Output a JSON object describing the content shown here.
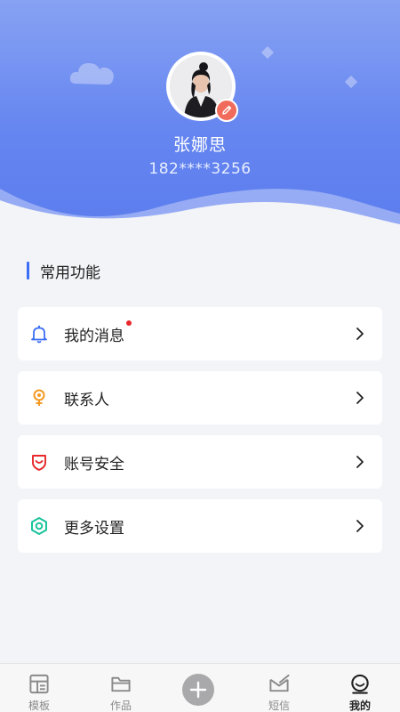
{
  "profile": {
    "name": "张娜思",
    "phone": "182****3256"
  },
  "section": {
    "title": "常用功能"
  },
  "menu": [
    {
      "label": "我的消息",
      "icon": "bell-icon",
      "has_dot": true
    },
    {
      "label": "联系人",
      "icon": "contact-icon",
      "has_dot": false
    },
    {
      "label": "账号安全",
      "icon": "shield-icon",
      "has_dot": false
    },
    {
      "label": "更多设置",
      "icon": "settings-icon",
      "has_dot": false
    }
  ],
  "tabbar": {
    "items": [
      {
        "label": "模板",
        "icon": "template-icon",
        "active": false
      },
      {
        "label": "作品",
        "icon": "folder-icon",
        "active": false
      },
      {
        "label": "",
        "icon": "plus-icon",
        "active": false
      },
      {
        "label": "短信",
        "icon": "message-icon",
        "active": false
      },
      {
        "label": "我的",
        "icon": "profile-icon",
        "active": true
      }
    ]
  },
  "colors": {
    "header_top": "#87a2f3",
    "header_bottom": "#5b7cee",
    "accent": "#3b6ef6",
    "badge": "#f06b5b",
    "dot": "#e8272a"
  }
}
